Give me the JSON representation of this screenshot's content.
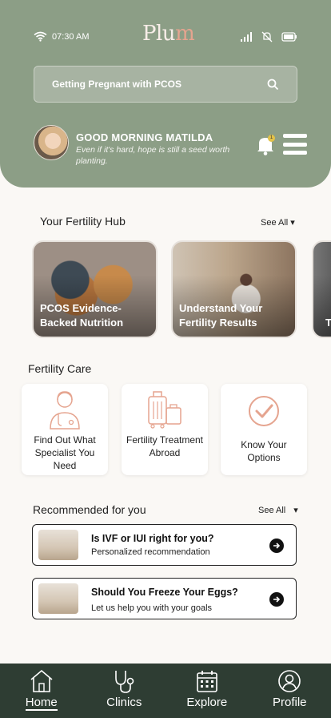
{
  "status": {
    "time": "07:30 AM"
  },
  "header": {
    "logo_main": "Plu",
    "logo_accent": "m",
    "search_placeholder": "Getting Pregnant with PCOS",
    "greeting": "GOOD MORNING MATILDA",
    "quote": "Even if it's hard, hope is still a seed worth planting.",
    "notification_count": "1"
  },
  "hub": {
    "title": "Your Fertility Hub",
    "see_all": "See All ▾",
    "cards": [
      {
        "label": "PCOS Evidence-Backed Nutrition"
      },
      {
        "label": "Understand Your Fertility Results"
      },
      {
        "label": "T"
      }
    ]
  },
  "care": {
    "title": "Fertility Care",
    "cards": [
      {
        "label": "Find Out What Specialist You Need",
        "icon": "doctor-icon"
      },
      {
        "label": "Fertility Treatment Abroad",
        "icon": "luggage-icon"
      },
      {
        "label": "Know Your Options",
        "icon": "check-circle-icon"
      }
    ]
  },
  "recommended": {
    "title": "Recommended for you",
    "see_all": "See All",
    "see_all_arrow": "▾",
    "items": [
      {
        "title": "Is IVF or IUI right for you?",
        "subtitle": "Personalized recommendation"
      },
      {
        "title": "Should You Freeze Your Eggs?",
        "subtitle": "Let us help you with your goals"
      }
    ]
  },
  "nav": [
    {
      "label": "Home",
      "icon": "home-icon",
      "active": true
    },
    {
      "label": "Clinics",
      "icon": "stethoscope-icon"
    },
    {
      "label": "Explore",
      "icon": "calendar-icon"
    },
    {
      "label": "Profile",
      "icon": "user-icon"
    }
  ],
  "colors": {
    "header_bg": "#8c9e86",
    "accent": "#e5a48f",
    "nav_bg": "#2e3d33"
  }
}
